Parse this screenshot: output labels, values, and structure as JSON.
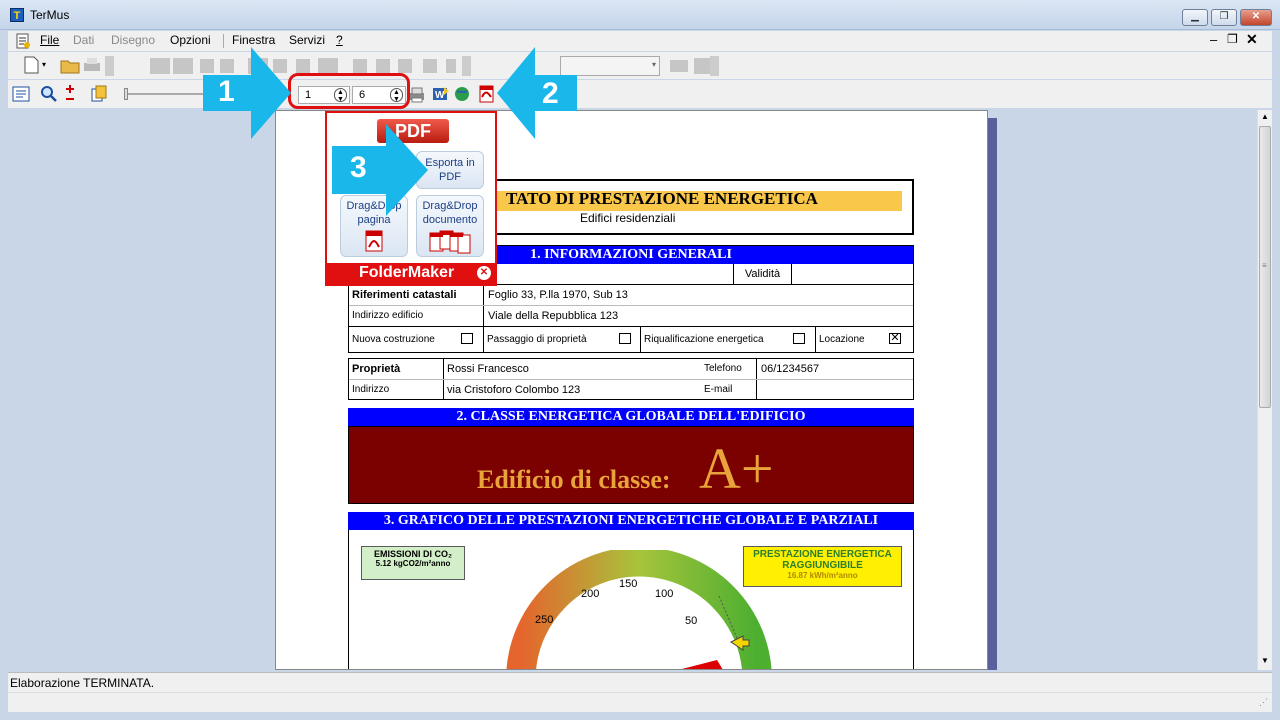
{
  "window": {
    "title": "TerMus",
    "app_icon": "T"
  },
  "menu": [
    "File",
    "Dati",
    "Disegno",
    "Opzioni",
    "Finestra",
    "Servizi",
    "?"
  ],
  "toolbar": {
    "page_from": "1",
    "page_to": "6"
  },
  "popup": {
    "logo": "PDF",
    "export_btn": "Esporta in PDF",
    "drag_page": "Drag&Drop pagina",
    "drag_doc": "Drag&Drop documento",
    "brand": "FolderMaker"
  },
  "callouts": [
    "1",
    "2",
    "3"
  ],
  "document": {
    "title": "TATO DI PRESTAZIONE ENERGETICA",
    "subtitle": "Edifici residenziali",
    "sec1": "1. INFORMAZIONI GENERALI",
    "validita": "Validità",
    "rif_label": "Riferimenti catastali",
    "rif_value": "Foglio 33, P.lla 1970, Sub 13",
    "addr_label": "Indirizzo edificio",
    "addr_value": "Viale della Repubblica 123",
    "checks": [
      "Nuova costruzione",
      "Passaggio di proprietà",
      "Riqualificazione energetica",
      "Locazione"
    ],
    "owner_label": "Proprietà",
    "owner_value": "Rossi Francesco",
    "owner_addr_label": "Indirizzo",
    "owner_addr_value": "via Cristoforo Colombo 123",
    "tel_label": "Telefono",
    "tel_value": "06/1234567",
    "email_label": "E-mail",
    "sec2": "2. CLASSE ENERGETICA GLOBALE DELL'EDIFICIO",
    "class_text": "Edificio di classe:",
    "class_value": "A+",
    "sec3": "3. GRAFICO DELLE PRESTAZIONI ENERGETICHE GLOBALE E PARZIALI",
    "emissioni_title": "EMISSIONI DI CO₂",
    "emissioni_value": "5.12 kgCO2/m²anno",
    "prestazione_title": "PRESTAZIONE ENERGETICA RAGGIUNGIBILE",
    "prestazione_value": "16.87 kWh/m²anno",
    "gauge_ticks": [
      "250",
      "200",
      "150",
      "100",
      "50"
    ]
  },
  "status": {
    "text": "Elaborazione TERMINATA."
  }
}
